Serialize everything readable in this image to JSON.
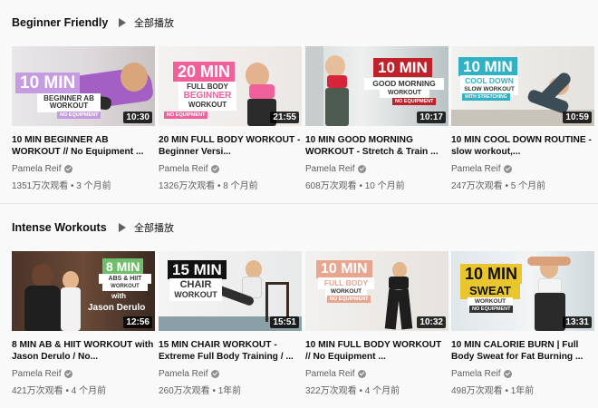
{
  "shelves": [
    {
      "title": "Beginner Friendly",
      "play_all": "全部播放",
      "videos": [
        {
          "title": "10 MIN BEGINNER AB WORKOUT // No Equipment ...",
          "channel": "Pamela Reif",
          "meta": "1351万次观看 • 3 个月前",
          "duration": "10:30",
          "thumb": {
            "big": "10 MIN",
            "sub": "BEGINNER AB WORKOUT",
            "tag": "NO EQUIPMENT",
            "accent": "#c79be0"
          }
        },
        {
          "title": "20 MIN FULL BODY WORKOUT - Beginner Versi...",
          "channel": "Pamela Reif",
          "meta": "1326万次观看 • 8 个月前",
          "duration": "21:55",
          "thumb": {
            "big": "20 MIN",
            "sub": "FULL BODY",
            "sub2": "BEGINNER",
            "sub3": "WORKOUT",
            "tag": "NO EQUIPMENT",
            "accent": "#f0609b"
          }
        },
        {
          "title": "10 MIN GOOD MORNING WORKOUT - Stretch & Train ...",
          "channel": "Pamela Reif",
          "meta": "608万次观看 • 10 个月前",
          "duration": "10:17",
          "thumb": {
            "big": "10 MIN",
            "sub": "GOOD MORNING",
            "sub2": "WORKOUT",
            "tag": "NO EQUIPMENT",
            "accent": "#c0222b"
          }
        },
        {
          "title": "10 MIN COOL DOWN ROUTINE - slow workout,...",
          "channel": "Pamela Reif",
          "meta": "247万次观看 • 5 个月前",
          "duration": "10:59",
          "thumb": {
            "big": "10 MIN",
            "sub": "COOL DOWN",
            "sub2": "SLOW WORKOUT",
            "tag": "WITH STRETCHING",
            "accent": "#2fb2c3"
          }
        }
      ]
    },
    {
      "title": "Intense Workouts",
      "play_all": "全部播放",
      "videos": [
        {
          "title": "8 MIN AB & HIIT WORKOUT with Jason Derulo / No...",
          "channel": "Pamela Reif",
          "meta": "421万次观看 • 4 个月前",
          "duration": "12:56",
          "thumb": {
            "big": "8 MIN",
            "sub": "ABS & HIIT",
            "sub2": "WORKOUT",
            "with": "with",
            "guest": "Jason Derulo",
            "accent": "#6fbf6a"
          }
        },
        {
          "title": "15 MIN CHAIR WORKOUT - Extreme Full Body Training / ...",
          "channel": "Pamela Reif",
          "meta": "260万次观看 • 1年前",
          "duration": "15:51",
          "thumb": {
            "big": "15 MIN",
            "sub": "CHAIR",
            "sub2": "WORKOUT",
            "accent": "#111111"
          }
        },
        {
          "title": "10 MIN FULL BODY WORKOUT // No Equipment ...",
          "channel": "Pamela Reif",
          "meta": "322万次观看 • 4 个月前",
          "duration": "10:32",
          "thumb": {
            "big": "10 MIN",
            "sub": "FULL BODY",
            "sub2": "WORKOUT",
            "tag": "NO EQUIPMENT",
            "accent": "#e8a58f"
          }
        },
        {
          "title": "10 MIN CALORIE BURN | Full Body Sweat for Fat Burning ...",
          "channel": "Pamela Reif",
          "meta": "498万次观看 • 1年前",
          "duration": "13:31",
          "thumb": {
            "big": "10 MIN",
            "sub": "SWEAT",
            "sub2": "WORKOUT",
            "tag": "NO EQUIPMENT",
            "accent": "#e9c62e"
          }
        }
      ]
    }
  ],
  "icons": {
    "play_all": "play-icon",
    "verified": "verified-check-icon"
  }
}
